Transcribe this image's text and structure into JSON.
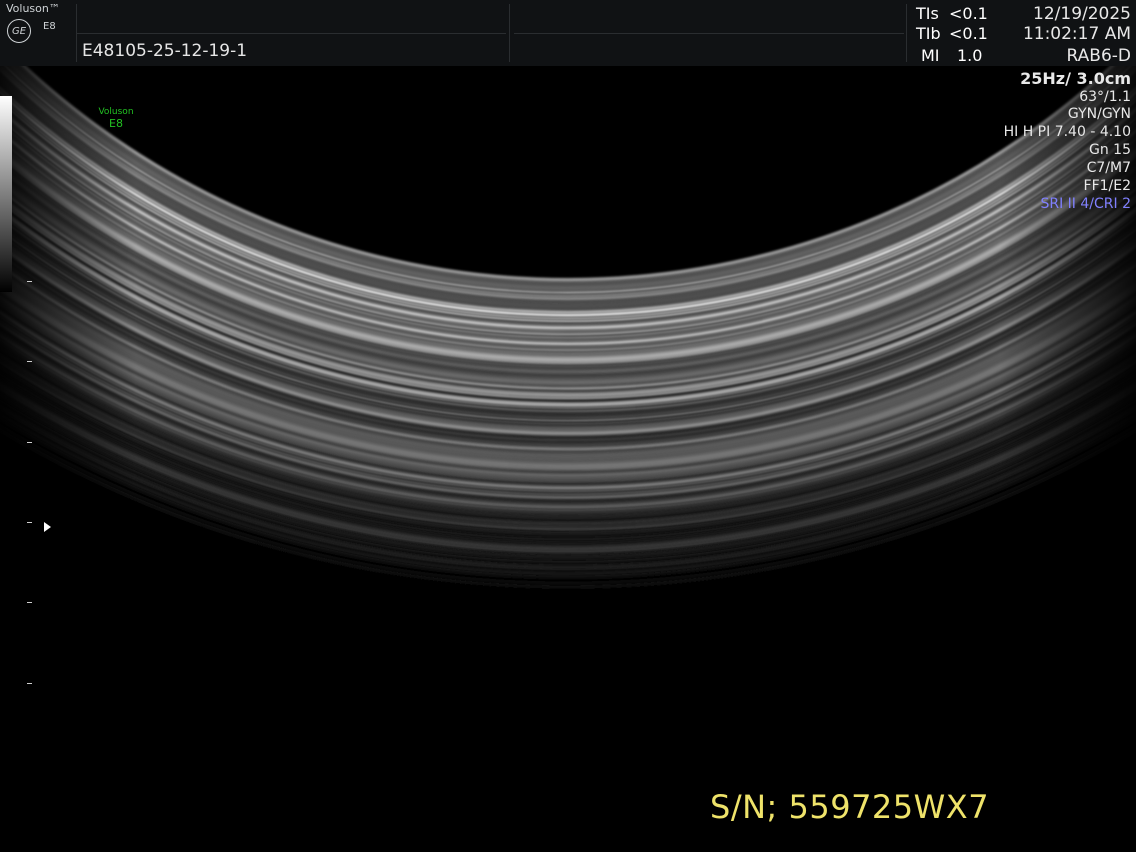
{
  "header": {
    "brand": "Voluson™",
    "logo_text": "GE",
    "model": "E8",
    "patient_id": "E48105-25-12-19-1",
    "indices": [
      {
        "label": "TIs",
        "value": "<0.1"
      },
      {
        "label": "TIb",
        "value": "<0.1"
      },
      {
        "label": "MI",
        "value": "1.0"
      }
    ],
    "date": "12/19/2025",
    "time": "11:02:17 AM",
    "probe": "RAB6-D"
  },
  "params": {
    "frame_depth": "25Hz/ 3.0cm",
    "angle": "63°/1.1",
    "preset": "GYN/GYN",
    "harmonic": "HI H PI 7.40 - 4.10",
    "gain": "Gn  15",
    "cm": "C7/M7",
    "ff": "FF1/E2",
    "sri": "SRI II 4/CRI 2"
  },
  "watermark": {
    "line1": "Voluson",
    "line2": "E8"
  },
  "serial": "S/N; 559725WX7",
  "colors": {
    "sri": "#8080ff",
    "watermark": "#22c022",
    "serial": "#efe36a"
  },
  "depth_marker_count": 6
}
